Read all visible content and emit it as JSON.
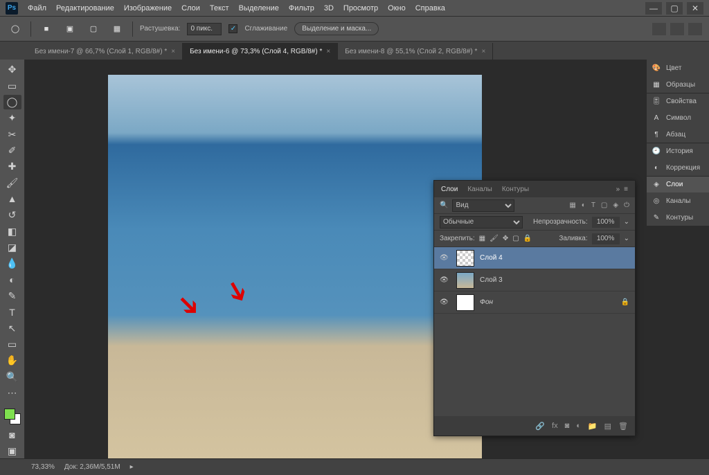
{
  "menu": [
    "Файл",
    "Редактирование",
    "Изображение",
    "Слои",
    "Текст",
    "Выделение",
    "Фильтр",
    "3D",
    "Просмотр",
    "Окно",
    "Справка"
  ],
  "options": {
    "feather_label": "Растушевка:",
    "feather_value": "0 пикс.",
    "antialias": "Сглаживание",
    "select_mask": "Выделение и маска..."
  },
  "tabs": [
    {
      "label": "Без имени-7 @ 66,7% (Слой 1, RGB/8#) *",
      "active": false
    },
    {
      "label": "Без имени-6 @ 73,3% (Слой 4, RGB/8#) *",
      "active": true
    },
    {
      "label": "Без имени-8 @ 55,1% (Слой 2, RGB/8#) *",
      "active": false
    }
  ],
  "side_panels": [
    {
      "label": "Цвет",
      "icon": "🎨"
    },
    {
      "label": "Образцы",
      "icon": "▦"
    },
    {
      "label": "Свойства",
      "icon": "🎚"
    },
    {
      "label": "Символ",
      "icon": "A"
    },
    {
      "label": "Абзац",
      "icon": "¶"
    },
    {
      "label": "История",
      "icon": "🕘"
    },
    {
      "label": "Коррекция",
      "icon": "◐"
    },
    {
      "label": "Слои",
      "icon": "◈",
      "active": true
    },
    {
      "label": "Каналы",
      "icon": "◎"
    },
    {
      "label": "Контуры",
      "icon": "✎"
    }
  ],
  "layers_panel": {
    "tabs": [
      "Слои",
      "Каналы",
      "Контуры"
    ],
    "search_label": "Вид",
    "blend": "Обычные",
    "opacity_label": "Непрозрачность:",
    "opacity_value": "100%",
    "lock_label": "Закрепить:",
    "fill_label": "Заливка:",
    "fill_value": "100%",
    "layers": [
      {
        "name": "Слой 4",
        "active": true,
        "thumb": "checker"
      },
      {
        "name": "Слой 3",
        "active": false,
        "thumb": "img"
      },
      {
        "name": "Фон",
        "active": false,
        "thumb": "white",
        "locked": true
      }
    ]
  },
  "status": {
    "zoom": "73,33%",
    "doc": "Док: 2,36M/5,51M"
  },
  "tools": [
    "↔",
    "▭",
    "◯",
    "◢",
    "✂",
    "⊡",
    "✐",
    "⊘",
    "⟋",
    "△",
    "✎",
    "⎌",
    "⦿",
    "T",
    "↖",
    "▱",
    "✋",
    "⊕"
  ],
  "swatches": {
    "fg": "#7fe04f",
    "bg": "#ffffff"
  }
}
